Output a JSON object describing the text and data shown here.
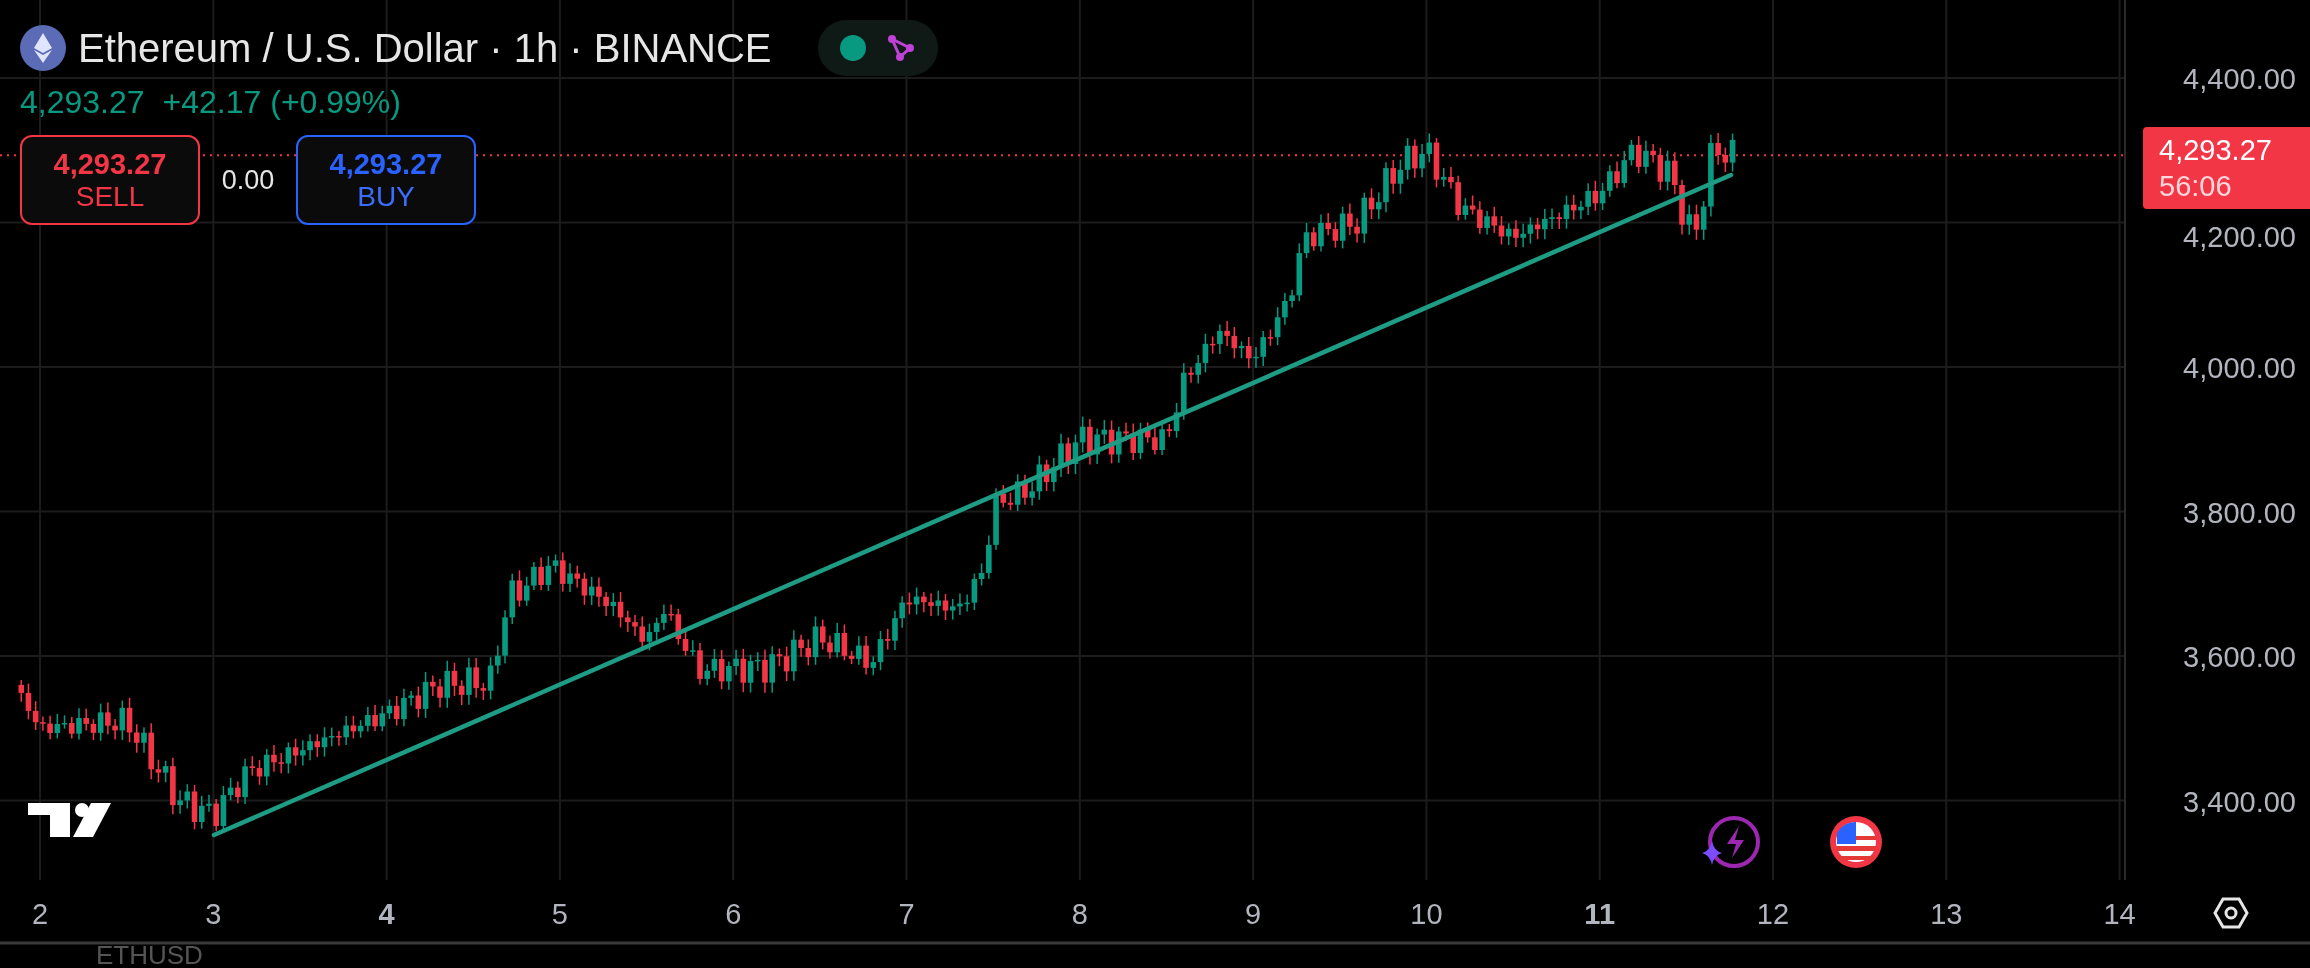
{
  "header": {
    "title": "Ethereum / U.S. Dollar · 1h · BINANCE",
    "live": true
  },
  "quote": {
    "last": "4,293.27",
    "change": "+42.17 (+0.99%)"
  },
  "trade": {
    "sell": {
      "price": "4,293.27",
      "label": "SELL"
    },
    "spread": "0.00",
    "buy": {
      "price": "4,293.27",
      "label": "BUY"
    }
  },
  "price_axis": {
    "ticks": [
      "4,400.00",
      "4,200.00",
      "4,000.00",
      "3,800.00",
      "3,600.00",
      "3,400.00"
    ],
    "current": {
      "price": "4,293.27",
      "countdown": "56:06"
    }
  },
  "time_axis": {
    "ticks": [
      {
        "label": "2",
        "emphasized": false
      },
      {
        "label": "3",
        "emphasized": false
      },
      {
        "label": "4",
        "emphasized": true
      },
      {
        "label": "5",
        "emphasized": false
      },
      {
        "label": "6",
        "emphasized": false
      },
      {
        "label": "7",
        "emphasized": false
      },
      {
        "label": "8",
        "emphasized": false
      },
      {
        "label": "9",
        "emphasized": false
      },
      {
        "label": "10",
        "emphasized": false
      },
      {
        "label": "11",
        "emphasized": true
      },
      {
        "label": "12",
        "emphasized": false
      },
      {
        "label": "13",
        "emphasized": false
      },
      {
        "label": "14",
        "emphasized": false
      }
    ]
  },
  "symbol": "ETHUSD"
}
